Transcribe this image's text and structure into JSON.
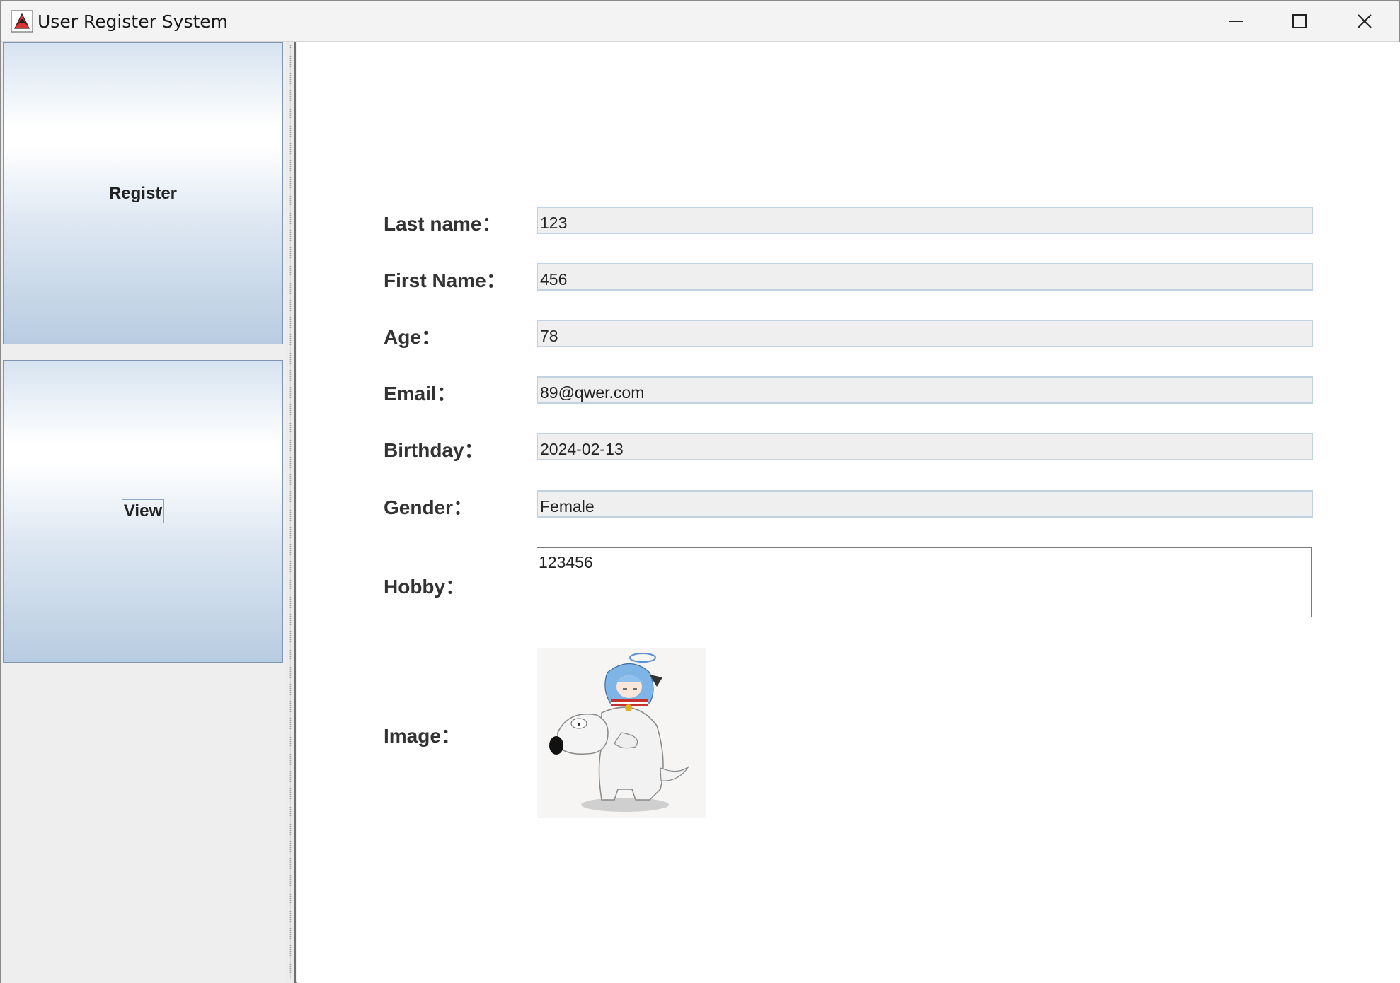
{
  "window": {
    "title": "User Register System",
    "icon": "java-app-icon",
    "controls": {
      "minimize": "minimize-icon",
      "maximize": "maximize-icon",
      "close": "close-icon"
    }
  },
  "sidebar": {
    "register_label": "Register",
    "view_label": "View"
  },
  "form": {
    "last_name_label": "Last name：",
    "last_name_value": "123",
    "first_name_label": "First Name：",
    "first_name_value": "456",
    "age_label": "Age：",
    "age_value": "78",
    "email_label": "Email：",
    "email_value": "89@qwer.com",
    "birthday_label": "Birthday：",
    "birthday_value": "2024-02-13",
    "gender_label": "Gender：",
    "gender_value": "Female",
    "hobby_label": "Hobby：",
    "hobby_value": "123456",
    "image_label": "Image：",
    "image_desc": "cartoon-dog-with-anime-girl"
  }
}
